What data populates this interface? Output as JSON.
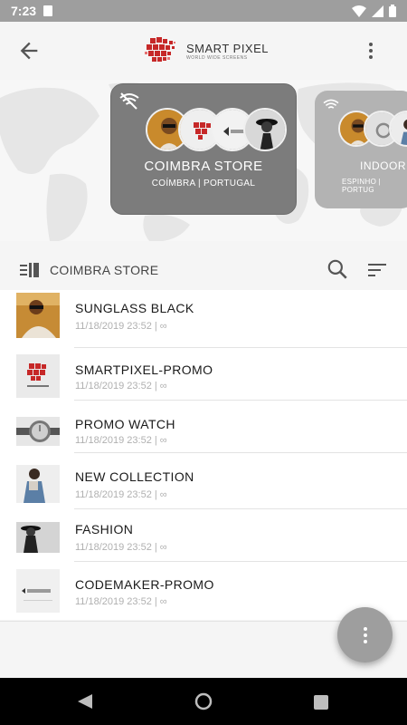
{
  "status_bar": {
    "time": "7:23"
  },
  "app_bar": {
    "brand_name": "SMART PIXEL",
    "brand_tagline": "WORLD WIDE SCREENS"
  },
  "stores": [
    {
      "name": "COIMBRA STORE",
      "location": "COÍMBRA | PORTUGAL",
      "selected": true,
      "wifi": "off"
    },
    {
      "name": "INDOOR",
      "location": "ESPINHO | PORTUG",
      "selected": false,
      "wifi": "on"
    }
  ],
  "list_header": {
    "title": "COIMBRA STORE"
  },
  "items": [
    {
      "title": "SUNGLASS BLACK",
      "subtitle": "11/18/2019 23:52 | ∞",
      "thumb": "sunglass-photo-thumbnail"
    },
    {
      "title": "SMARTPIXEL-PROMO",
      "subtitle": "11/18/2019 23:52 | ∞",
      "thumb": "smartpixel-logo-thumbnail"
    },
    {
      "title": "PROMO WATCH",
      "subtitle": "11/18/2019 23:52 | ∞",
      "thumb": "watch-photo-thumbnail"
    },
    {
      "title": "NEW COLLECTION",
      "subtitle": "11/18/2019 23:52 | ∞",
      "thumb": "model-photo-thumbnail"
    },
    {
      "title": "FASHION",
      "subtitle": "11/18/2019 23:52 | ∞",
      "thumb": "fashion-photo-thumbnail"
    },
    {
      "title": "CODEMAKER-PROMO",
      "subtitle": "11/18/2019 23:52 | ∞",
      "thumb": "codemaker-logo-thumbnail"
    }
  ],
  "colors": {
    "brand_red": "#c62828",
    "card_active": "#7c7c7c",
    "card_inactive": "#b3b3b3",
    "fab": "#9e9e9e"
  }
}
